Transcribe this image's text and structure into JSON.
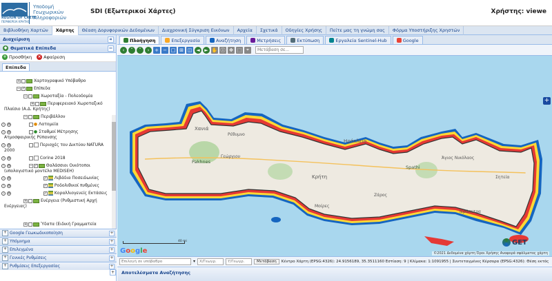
{
  "header": {
    "org_line1": "REGION OF CRETE",
    "org_line2": "ΠΕΡΙΦΕΡΕΙΑ ΚΡΗΤΗΣ",
    "infra_line1": "Υποδομή",
    "infra_line2": "Γεωχωρικών",
    "infra_line3": "Πληροφοριών",
    "app_title": "SDI (Εξωτερικοί Χάρτες)",
    "user_label": "Χρήστης: viewe"
  },
  "menubar": {
    "items": [
      "Βιβλιοθήκη Χαρτών",
      "Χάρτης",
      "Θέαση Δορυφορικών Δεδομένων",
      "Διαχρονική Σύγκριση Εικόνων",
      "Αρχεία",
      "Σχετικά",
      "Οδηγίες Χρήσης",
      "Πείτε μας τη γνώμη σας",
      "Φόρμα Υποστήριξης Χρηστών"
    ],
    "active_index": 1
  },
  "left": {
    "panel_title": "Διαχείριση",
    "layers_title": "Θεματικά Επίπεδα",
    "add_label": "Προσθήκη",
    "remove_label": "Αφαίρεση",
    "subtab_label": "Επίπεδα",
    "tree": {
      "basemaps": "Χαρτογραφικό Υπόβαθρο",
      "layers": "Επίπεδα",
      "zoning": "Χωροταξία - Πολεοδομία",
      "rsfp_1": "Περιφερειακό Χωροταξικό",
      "rsfp_2": "Πλαίσιο (Α.Δ. Κρήτης)",
      "environment": "Περιβάλλον",
      "quarries": "Λατομεία",
      "stations_1": "Σταθμοί Μέτρησης",
      "stations_2": "Ατμοσφαιρικής Ρύπανσης",
      "natura_1": "Περιοχές του Δικτύου NATURA",
      "natura_2": "2000",
      "corine": "Corine 2018",
      "marine_1": "Θαλάσσιοι Οικότοποι",
      "marine_2": "(υπολογιστικό μοντέλο MEDISEH)",
      "posidonia": "Λιβάδια Ποσειδωνίας",
      "rhodolith": "Ροδολιθικοί πυθμένες",
      "coralligenous": "Κοραλλιογενείς Εκτάσεις",
      "energy_1": "Ενέργεια (Ρυθμιστική Αρχή",
      "energy_2": "Ενέργειας)",
      "water": "Ύδατα (Ειδική Γραμματεία"
    },
    "accordion": [
      "Google Γεωκωδικοποίηση",
      "Υπόμνημα",
      "Επιλεγμένα",
      "Γενικές Ρυθμίσεις",
      "Ρυθμίσεις Επεξεργασίας"
    ]
  },
  "map_tabs": [
    {
      "label": "Πλοήγηση",
      "icon": "navigation-icon"
    },
    {
      "label": "Επεξεργασία",
      "icon": "edit-icon"
    },
    {
      "label": "Αναζήτηση",
      "icon": "search-icon"
    },
    {
      "label": "Μετρήσεις",
      "icon": "ruler-icon"
    },
    {
      "label": "Εκτύπωση",
      "icon": "print-icon"
    },
    {
      "label": "Εργαλεία Sentinel-Hub",
      "icon": "satellite-icon"
    },
    {
      "label": "Google",
      "icon": "google-icon"
    }
  ],
  "map_search_placeholder": "Μετάβαση σε...",
  "map": {
    "labels": [
      {
        "text": "Χανιά"
      },
      {
        "text": "Pakhnes"
      },
      {
        "text": "Ρέθυμνο"
      },
      {
        "text": "Ηράκλειο"
      },
      {
        "text": "Γεώργιου"
      },
      {
        "text": "Κρήτη"
      },
      {
        "text": "Spathi"
      },
      {
        "text": "Μοίρες"
      },
      {
        "text": "Ζάρος"
      },
      {
        "text": "Άγιος Νικόλαος"
      },
      {
        "text": "Σητεία"
      },
      {
        "text": "Ιεράπετρα"
      }
    ],
    "scale_label": "40 mi",
    "attribution": "©2021 Δεδομένα χάρτη   Όροι Χρήσης   Αναφορά σφάλματος χάρτη",
    "google_logo": "Google",
    "get_logo_text": "GET"
  },
  "statusbar": {
    "search_placeholder": "Επιλογή σε υπόβαθρο",
    "x_placeholder": "Χ/Γεωγρ.",
    "y_placeholder": "Υ/Γεωγρ.",
    "goto_label": "Μετάβαση",
    "info": "Κέντρο Χάρτη (EPSG:4326): 24.9156189, 35.3511160 Εστίαση: 9 | Κλίμακα: 1:1091955 | Συντεταγμένες Κέρσορα (EPSG:4326): Θέση εκτός"
  },
  "results_title": "Αποτελέσματα Αναζήτησης"
}
